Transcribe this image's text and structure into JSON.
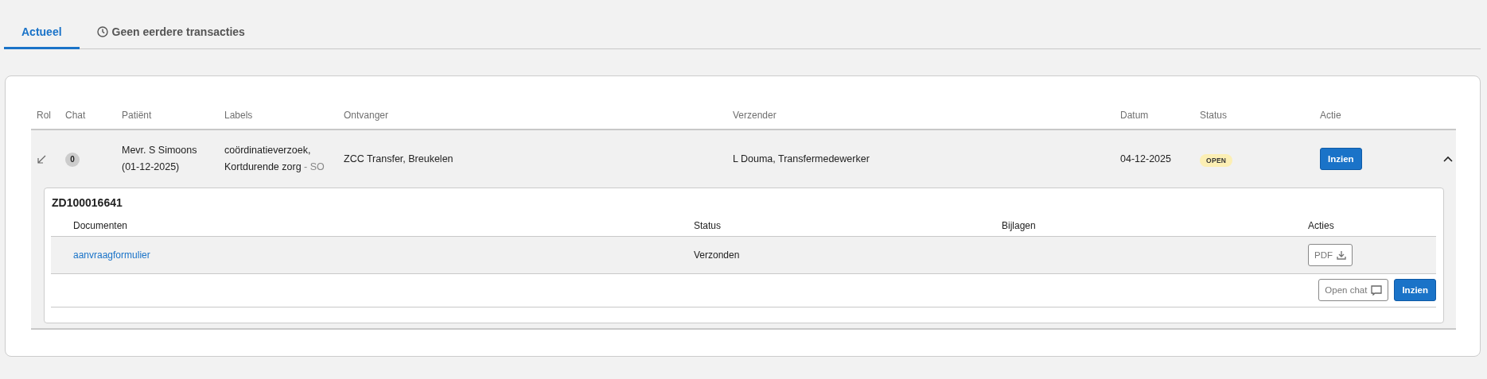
{
  "tabs": [
    {
      "label": "Actueel",
      "selected": true,
      "kind": "plain"
    },
    {
      "label": "Geen eerdere transacties",
      "selected": false,
      "kind": "history"
    }
  ],
  "table": {
    "columns": [
      "Rol",
      "Chat",
      "Patiënt",
      "Labels",
      "Ontvanger",
      "Verzender",
      "Datum",
      "Status",
      "Actie"
    ],
    "rows": [
      {
        "chat": "0",
        "patient": [
          "Mevr. S Simoons",
          "(01-12-2025)"
        ],
        "labels": [
          "coördinatieverzoek,",
          "Kortdurende zorg"
        ],
        "label_suffix": "- SO",
        "ontvanger": "ZCC Transfer, Breukelen",
        "verzender": "L Douma, Transfermedewerker",
        "datum": "04-12-2025",
        "status": "OPEN",
        "action": "Inzien",
        "expanded": true,
        "detail": {
          "title": "ZD100016641",
          "columns": [
            "Documenten",
            "Status",
            "Bijlagen",
            "Acties"
          ],
          "documents": [
            {
              "name": "aanvraagformulier",
              "status": "Verzonden",
              "action": "PDF"
            }
          ],
          "buttons": [
            {
              "label": "Open chat",
              "kind": "secondary"
            },
            {
              "label": "Inzien",
              "kind": "primary"
            }
          ]
        }
      }
    ]
  }
}
